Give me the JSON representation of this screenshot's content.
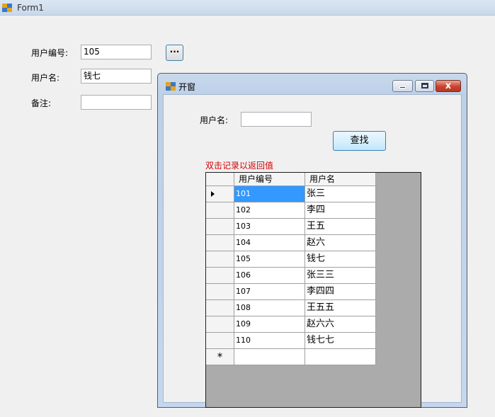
{
  "main_window": {
    "title": "Form1",
    "labels": {
      "user_id": "用户编号:",
      "user_name": "用户名:",
      "remark": "备注:"
    },
    "fields": {
      "user_id": "105",
      "user_name": "钱七",
      "remark": ""
    },
    "browse_button_label": "···"
  },
  "dialog": {
    "title": "开窗",
    "search_label": "用户名:",
    "search_value": "",
    "search_button_label": "查找",
    "hint_text": "双击记录以返回值",
    "close_glyph": "x",
    "grid": {
      "columns": [
        "用户编号",
        "用户名"
      ],
      "current_row_index": 0,
      "new_row_marker": "*",
      "rows": [
        {
          "id": "101",
          "name": "张三"
        },
        {
          "id": "102",
          "name": "李四"
        },
        {
          "id": "103",
          "name": "王五"
        },
        {
          "id": "104",
          "name": "赵六"
        },
        {
          "id": "105",
          "name": "钱七"
        },
        {
          "id": "106",
          "name": "张三三"
        },
        {
          "id": "107",
          "name": "李四四"
        },
        {
          "id": "108",
          "name": "王五五"
        },
        {
          "id": "109",
          "name": "赵六六"
        },
        {
          "id": "110",
          "name": "钱七七"
        }
      ]
    }
  },
  "colors": {
    "selection": "#3399ff",
    "hint": "#d40000",
    "grid_background": "#ababab"
  }
}
